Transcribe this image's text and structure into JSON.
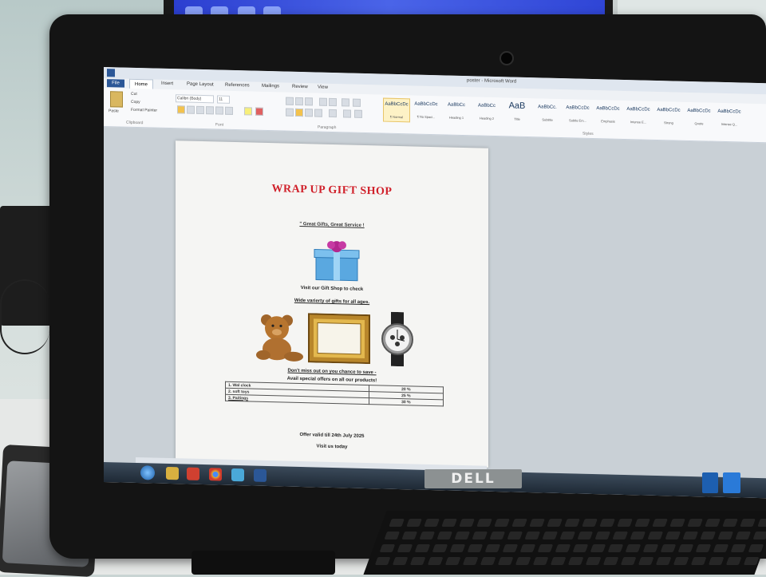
{
  "window": {
    "title": "poster - Microsoft Word",
    "tabs": [
      "File",
      "Home",
      "Insert",
      "Page Layout",
      "References",
      "Mailings",
      "Review",
      "View"
    ]
  },
  "ribbon": {
    "clipboard": {
      "paste": "Paste",
      "cut": "Cut",
      "copy": "Copy",
      "format_painter": "Format Painter",
      "group": "Clipboard"
    },
    "font": {
      "name": "Calibri (Body)",
      "size": "11",
      "group": "Font"
    },
    "paragraph": {
      "group": "Paragraph"
    },
    "styles": [
      {
        "sample": "AaBbCcDc",
        "name": "¶ Normal"
      },
      {
        "sample": "AaBbCcDc",
        "name": "¶ No Spaci..."
      },
      {
        "sample": "AaBbCc",
        "name": "Heading 1"
      },
      {
        "sample": "AaBbCc",
        "name": "Heading 2"
      },
      {
        "sample": "AaB",
        "name": "Title"
      },
      {
        "sample": "AaBbCc.",
        "name": "Subtitle"
      },
      {
        "sample": "AaBbCcDc",
        "name": "Subtle Em..."
      },
      {
        "sample": "AaBbCcDc",
        "name": "Emphasis"
      },
      {
        "sample": "AaBbCcDc",
        "name": "Intense E..."
      },
      {
        "sample": "AaBbCcDc",
        "name": "Strong"
      },
      {
        "sample": "AaBbCcDc",
        "name": "Quote"
      },
      {
        "sample": "AaBbCcDc",
        "name": "Intense Q..."
      }
    ],
    "styles_group": "Styles"
  },
  "document": {
    "title": "WRAP UP GIFT SHOP",
    "tagline": "\" Great Gifts, Great Service !",
    "line1": "Visit our Gift Shop to check",
    "line2": "Wide varierty of gifts for all ages.",
    "line3": "Don't miss out on you chance to save -",
    "line4": "Avail special offers on all our products!",
    "offers": [
      {
        "item": "1.    Wal clock",
        "discount": "20 %"
      },
      {
        "item": "2.    soft toys",
        "discount": "25 %"
      },
      {
        "item": "3.    Paitings",
        "discount": "30 %"
      }
    ],
    "validity": "Offer valid till 24th July 2025",
    "closing": "Visit us today"
  },
  "brand": {
    "monitor": "DELL"
  },
  "colors": {
    "title_red": "#d0202a",
    "word_blue": "#2b5797",
    "bezel": "#141414"
  },
  "icons": [
    "gift-box-image",
    "teddy-bear-image",
    "picture-frame-image",
    "wrist-watch-image",
    "windows-start-icon",
    "chrome-icon",
    "word-icon"
  ]
}
